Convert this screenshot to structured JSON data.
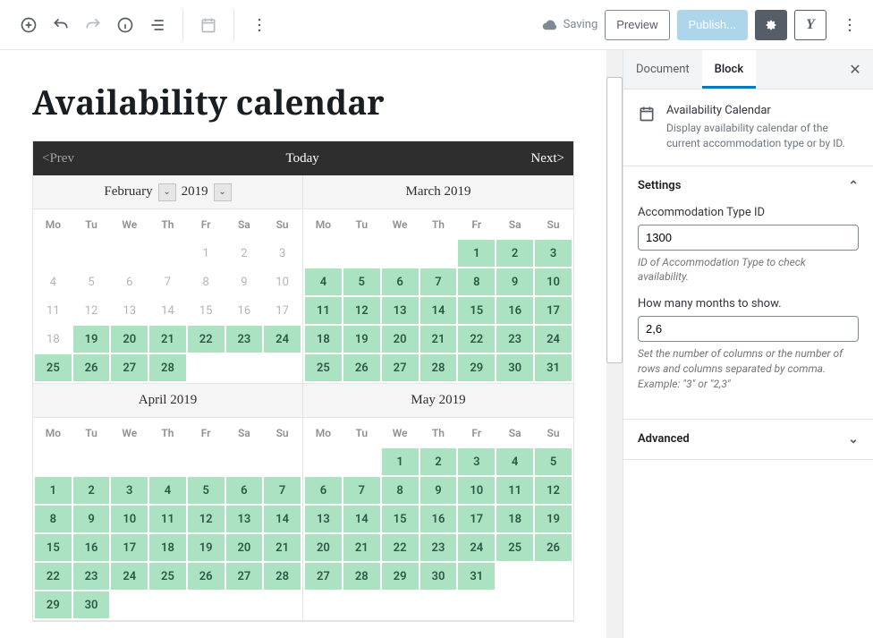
{
  "toolbar": {
    "saving_label": "Saving",
    "preview_label": "Preview",
    "publish_label": "Publish..."
  },
  "page_title": "Availability calendar",
  "cal_bar": {
    "prev": "<Prev",
    "today": "Today",
    "next": "Next>"
  },
  "weekdays": [
    "Mo",
    "Tu",
    "We",
    "Th",
    "Fr",
    "Sa",
    "Su"
  ],
  "months": [
    {
      "title": "February",
      "year": "2019",
      "has_picker": true,
      "weeks": [
        [
          {
            "d": ""
          },
          {
            "d": ""
          },
          {
            "d": ""
          },
          {
            "d": ""
          },
          {
            "d": "1",
            "dim": true
          },
          {
            "d": "2",
            "dim": true
          },
          {
            "d": "3",
            "dim": true
          }
        ],
        [
          {
            "d": "4",
            "dim": true
          },
          {
            "d": "5",
            "dim": true
          },
          {
            "d": "6",
            "dim": true
          },
          {
            "d": "7",
            "dim": true
          },
          {
            "d": "8",
            "dim": true
          },
          {
            "d": "9",
            "dim": true
          },
          {
            "d": "10",
            "dim": true
          }
        ],
        [
          {
            "d": "11",
            "dim": true
          },
          {
            "d": "12",
            "dim": true
          },
          {
            "d": "13",
            "dim": true
          },
          {
            "d": "14",
            "dim": true
          },
          {
            "d": "15",
            "dim": true
          },
          {
            "d": "16",
            "dim": true
          },
          {
            "d": "17",
            "dim": true
          }
        ],
        [
          {
            "d": "18",
            "dim": true
          },
          {
            "d": "19",
            "avail": true
          },
          {
            "d": "20",
            "avail": true
          },
          {
            "d": "21",
            "avail": true
          },
          {
            "d": "22",
            "avail": true
          },
          {
            "d": "23",
            "avail": true
          },
          {
            "d": "24",
            "avail": true
          }
        ],
        [
          {
            "d": "25",
            "avail": true
          },
          {
            "d": "26",
            "avail": true
          },
          {
            "d": "27",
            "avail": true
          },
          {
            "d": "28",
            "avail": true
          },
          {
            "d": ""
          },
          {
            "d": ""
          },
          {
            "d": ""
          }
        ]
      ]
    },
    {
      "title": "March 2019",
      "has_picker": false,
      "weeks": [
        [
          {
            "d": ""
          },
          {
            "d": ""
          },
          {
            "d": ""
          },
          {
            "d": ""
          },
          {
            "d": "1",
            "avail": true
          },
          {
            "d": "2",
            "avail": true
          },
          {
            "d": "3",
            "avail": true
          }
        ],
        [
          {
            "d": "4",
            "avail": true
          },
          {
            "d": "5",
            "avail": true
          },
          {
            "d": "6",
            "avail": true
          },
          {
            "d": "7",
            "avail": true
          },
          {
            "d": "8",
            "avail": true
          },
          {
            "d": "9",
            "avail": true
          },
          {
            "d": "10",
            "avail": true
          }
        ],
        [
          {
            "d": "11",
            "avail": true
          },
          {
            "d": "12",
            "avail": true
          },
          {
            "d": "13",
            "avail": true
          },
          {
            "d": "14",
            "avail": true
          },
          {
            "d": "15",
            "avail": true
          },
          {
            "d": "16",
            "avail": true
          },
          {
            "d": "17",
            "avail": true
          }
        ],
        [
          {
            "d": "18",
            "avail": true
          },
          {
            "d": "19",
            "avail": true
          },
          {
            "d": "20",
            "avail": true
          },
          {
            "d": "21",
            "avail": true
          },
          {
            "d": "22",
            "avail": true
          },
          {
            "d": "23",
            "avail": true
          },
          {
            "d": "24",
            "avail": true
          }
        ],
        [
          {
            "d": "25",
            "avail": true
          },
          {
            "d": "26",
            "avail": true
          },
          {
            "d": "27",
            "avail": true
          },
          {
            "d": "28",
            "avail": true
          },
          {
            "d": "29",
            "avail": true
          },
          {
            "d": "30",
            "avail": true
          },
          {
            "d": "31",
            "avail": true
          }
        ]
      ]
    },
    {
      "title": "April 2019",
      "has_picker": false,
      "weeks": [
        [
          {
            "d": ""
          },
          {
            "d": ""
          },
          {
            "d": ""
          },
          {
            "d": ""
          },
          {
            "d": ""
          },
          {
            "d": ""
          },
          {
            "d": ""
          }
        ],
        [
          {
            "d": "1",
            "avail": true
          },
          {
            "d": "2",
            "avail": true
          },
          {
            "d": "3",
            "avail": true
          },
          {
            "d": "4",
            "avail": true
          },
          {
            "d": "5",
            "avail": true
          },
          {
            "d": "6",
            "avail": true
          },
          {
            "d": "7",
            "avail": true
          }
        ],
        [
          {
            "d": "8",
            "avail": true
          },
          {
            "d": "9",
            "avail": true
          },
          {
            "d": "10",
            "avail": true
          },
          {
            "d": "11",
            "avail": true
          },
          {
            "d": "12",
            "avail": true
          },
          {
            "d": "13",
            "avail": true
          },
          {
            "d": "14",
            "avail": true
          }
        ],
        [
          {
            "d": "15",
            "avail": true
          },
          {
            "d": "16",
            "avail": true
          },
          {
            "d": "17",
            "avail": true
          },
          {
            "d": "18",
            "avail": true
          },
          {
            "d": "19",
            "avail": true
          },
          {
            "d": "20",
            "avail": true
          },
          {
            "d": "21",
            "avail": true
          }
        ],
        [
          {
            "d": "22",
            "avail": true
          },
          {
            "d": "23",
            "avail": true
          },
          {
            "d": "24",
            "avail": true
          },
          {
            "d": "25",
            "avail": true
          },
          {
            "d": "26",
            "avail": true
          },
          {
            "d": "27",
            "avail": true
          },
          {
            "d": "28",
            "avail": true
          }
        ],
        [
          {
            "d": "29",
            "avail": true
          },
          {
            "d": "30",
            "avail": true
          },
          {
            "d": ""
          },
          {
            "d": ""
          },
          {
            "d": ""
          },
          {
            "d": ""
          },
          {
            "d": ""
          }
        ]
      ]
    },
    {
      "title": "May 2019",
      "has_picker": false,
      "weeks": [
        [
          {
            "d": ""
          },
          {
            "d": ""
          },
          {
            "d": "1",
            "avail": true
          },
          {
            "d": "2",
            "avail": true
          },
          {
            "d": "3",
            "avail": true
          },
          {
            "d": "4",
            "avail": true
          },
          {
            "d": "5",
            "avail": true
          }
        ],
        [
          {
            "d": "6",
            "avail": true
          },
          {
            "d": "7",
            "avail": true
          },
          {
            "d": "8",
            "avail": true
          },
          {
            "d": "9",
            "avail": true
          },
          {
            "d": "10",
            "avail": true
          },
          {
            "d": "11",
            "avail": true
          },
          {
            "d": "12",
            "avail": true
          }
        ],
        [
          {
            "d": "13",
            "avail": true
          },
          {
            "d": "14",
            "avail": true
          },
          {
            "d": "15",
            "avail": true
          },
          {
            "d": "16",
            "avail": true
          },
          {
            "d": "17",
            "avail": true
          },
          {
            "d": "18",
            "avail": true
          },
          {
            "d": "19",
            "avail": true
          }
        ],
        [
          {
            "d": "20",
            "avail": true
          },
          {
            "d": "21",
            "avail": true
          },
          {
            "d": "22",
            "avail": true
          },
          {
            "d": "23",
            "avail": true
          },
          {
            "d": "24",
            "avail": true
          },
          {
            "d": "25",
            "avail": true
          },
          {
            "d": "26",
            "avail": true
          }
        ],
        [
          {
            "d": "27",
            "avail": true
          },
          {
            "d": "28",
            "avail": true
          },
          {
            "d": "29",
            "avail": true
          },
          {
            "d": "30",
            "avail": true
          },
          {
            "d": "31",
            "avail": true
          },
          {
            "d": ""
          },
          {
            "d": ""
          }
        ]
      ]
    }
  ],
  "sidebar": {
    "tabs": {
      "document": "Document",
      "block": "Block"
    },
    "block_info": {
      "title": "Availability Calendar",
      "desc": "Display availability calendar of the current accommodation type or by ID."
    },
    "panels": {
      "settings_title": "Settings",
      "advanced_title": "Advanced"
    },
    "fields": {
      "accom": {
        "label": "Accommodation Type ID",
        "value": "1300",
        "help": "ID of Accommodation Type to check availability."
      },
      "months": {
        "label": "How many months to show.",
        "value": "2,6",
        "help": "Set the number of columns or the number of rows and columns separated by comma. Example: \"3\" or \"2,3\""
      }
    }
  }
}
